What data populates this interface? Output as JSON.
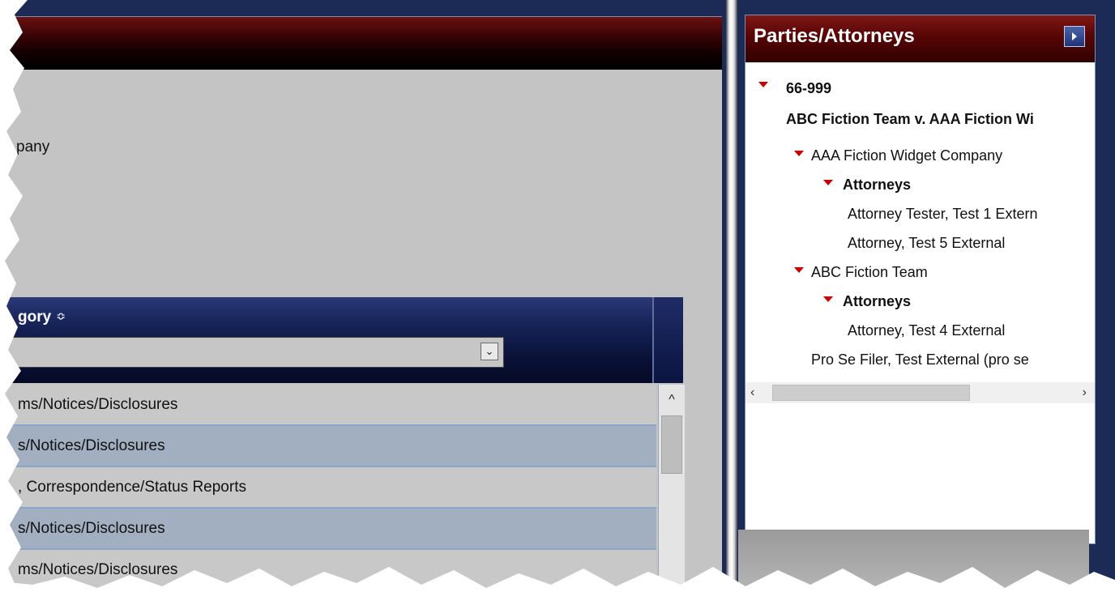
{
  "left": {
    "company_text": "pany",
    "grid": {
      "category_label": "gory",
      "sort_icon": "≎",
      "filter_dropdown_glyph": "⌄",
      "rows": [
        "ms/Notices/Disclosures",
        "s/Notices/Disclosures",
        ", Correspondence/Status Reports",
        "s/Notices/Disclosures",
        "ms/Notices/Disclosures"
      ],
      "scroll_up_glyph": "^"
    }
  },
  "parties": {
    "title": "Parties/Attorneys",
    "expand_icon": "caret-right-icon",
    "tree": {
      "case_number": "66-999",
      "case_title": "ABC Fiction Team v. AAA Fiction Wi",
      "party1": {
        "name": "AAA Fiction Widget Company",
        "attorneys_label": "Attorneys",
        "attorneys": [
          "Attorney Tester, Test 1 Extern",
          "Attorney, Test 5 External"
        ]
      },
      "party2": {
        "name": "ABC Fiction Team",
        "attorneys_label": "Attorneys",
        "attorneys": [
          "Attorney, Test 4 External"
        ]
      },
      "pro_se": "Pro Se Filer, Test External (pro se"
    },
    "hscroll_left": "‹",
    "hscroll_right": "›"
  },
  "colors": {
    "header_red": "#5b0606",
    "grid_header_navy": "#0a1238",
    "tree_arrow_red": "#cc0000",
    "row_alt_blue": "#a1afc0",
    "pane_navy": "#1c2a56"
  }
}
